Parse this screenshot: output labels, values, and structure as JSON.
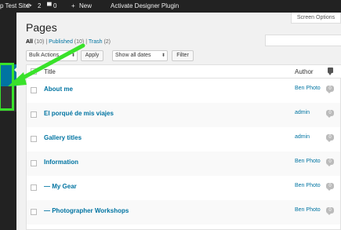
{
  "admin_bar": {
    "site_name": "p Test Site",
    "updates_count": "2",
    "comments_count": "0",
    "new_label": "New",
    "plugin_label": "Activate Designer Plugin",
    "icons": [
      "refresh-icon",
      "comment-icon",
      "plus-icon"
    ]
  },
  "screen_options_label": "Screen Options",
  "page_title": "Pages",
  "filters": {
    "all": "All",
    "all_count": "(10)",
    "published": "Published",
    "published_count": "(10)",
    "trash": "Trash",
    "trash_count": "(2)",
    "sep": "|"
  },
  "controls": {
    "bulk_actions": "Bulk Actions",
    "apply": "Apply",
    "dates": "Show all dates",
    "filter": "Filter"
  },
  "table": {
    "col_title": "Title",
    "col_author": "Author",
    "rows": [
      {
        "title": "About me",
        "author": "Ben Photo",
        "comments": "0"
      },
      {
        "title": "El porqué de mis viajes",
        "author": "admin",
        "comments": "0"
      },
      {
        "title": "Gallery titles",
        "author": "admin",
        "comments": "0"
      },
      {
        "title": "Information",
        "author": "Ben Photo",
        "comments": "0"
      },
      {
        "title": "— My Gear",
        "author": "Ben Photo",
        "comments": "0"
      },
      {
        "title": "— Photographer Workshops",
        "author": "Ben Photo",
        "comments": "0"
      }
    ]
  },
  "colors": {
    "admin_bar": "#222222",
    "link": "#0074a2",
    "annotation": "#39e22a"
  }
}
